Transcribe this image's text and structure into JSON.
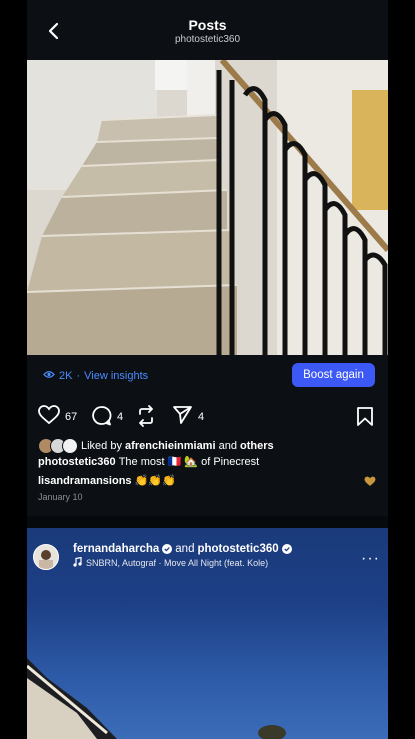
{
  "header": {
    "title": "Posts",
    "subtitle": "photostetic360"
  },
  "post": {
    "insights": {
      "views": "2K",
      "separator": "·",
      "link_label": "View insights",
      "boost_label": "Boost again"
    },
    "actions": {
      "likes": "67",
      "comments": "4",
      "shares": "4"
    },
    "liked_by": {
      "prefix": "Liked by",
      "user": "afrenchieinmiami",
      "connector": "and",
      "others": "others"
    },
    "caption": {
      "username": "photostetic360",
      "text": "The most 🇫🇷 🏡 of Pinecrest"
    },
    "comment": {
      "username": "lisandramansions",
      "text": "👏👏👏"
    },
    "date": "January 10"
  },
  "post2": {
    "user1": "fernandaharcha",
    "connector": "and",
    "user2": "photostetic360",
    "music": "SNBRN, Autograf · Move All Night (feat. Kole)",
    "more_label": "···"
  },
  "colors": {
    "background": "#0c1014",
    "accent": "#3d59f5",
    "link": "#4a8cff"
  }
}
